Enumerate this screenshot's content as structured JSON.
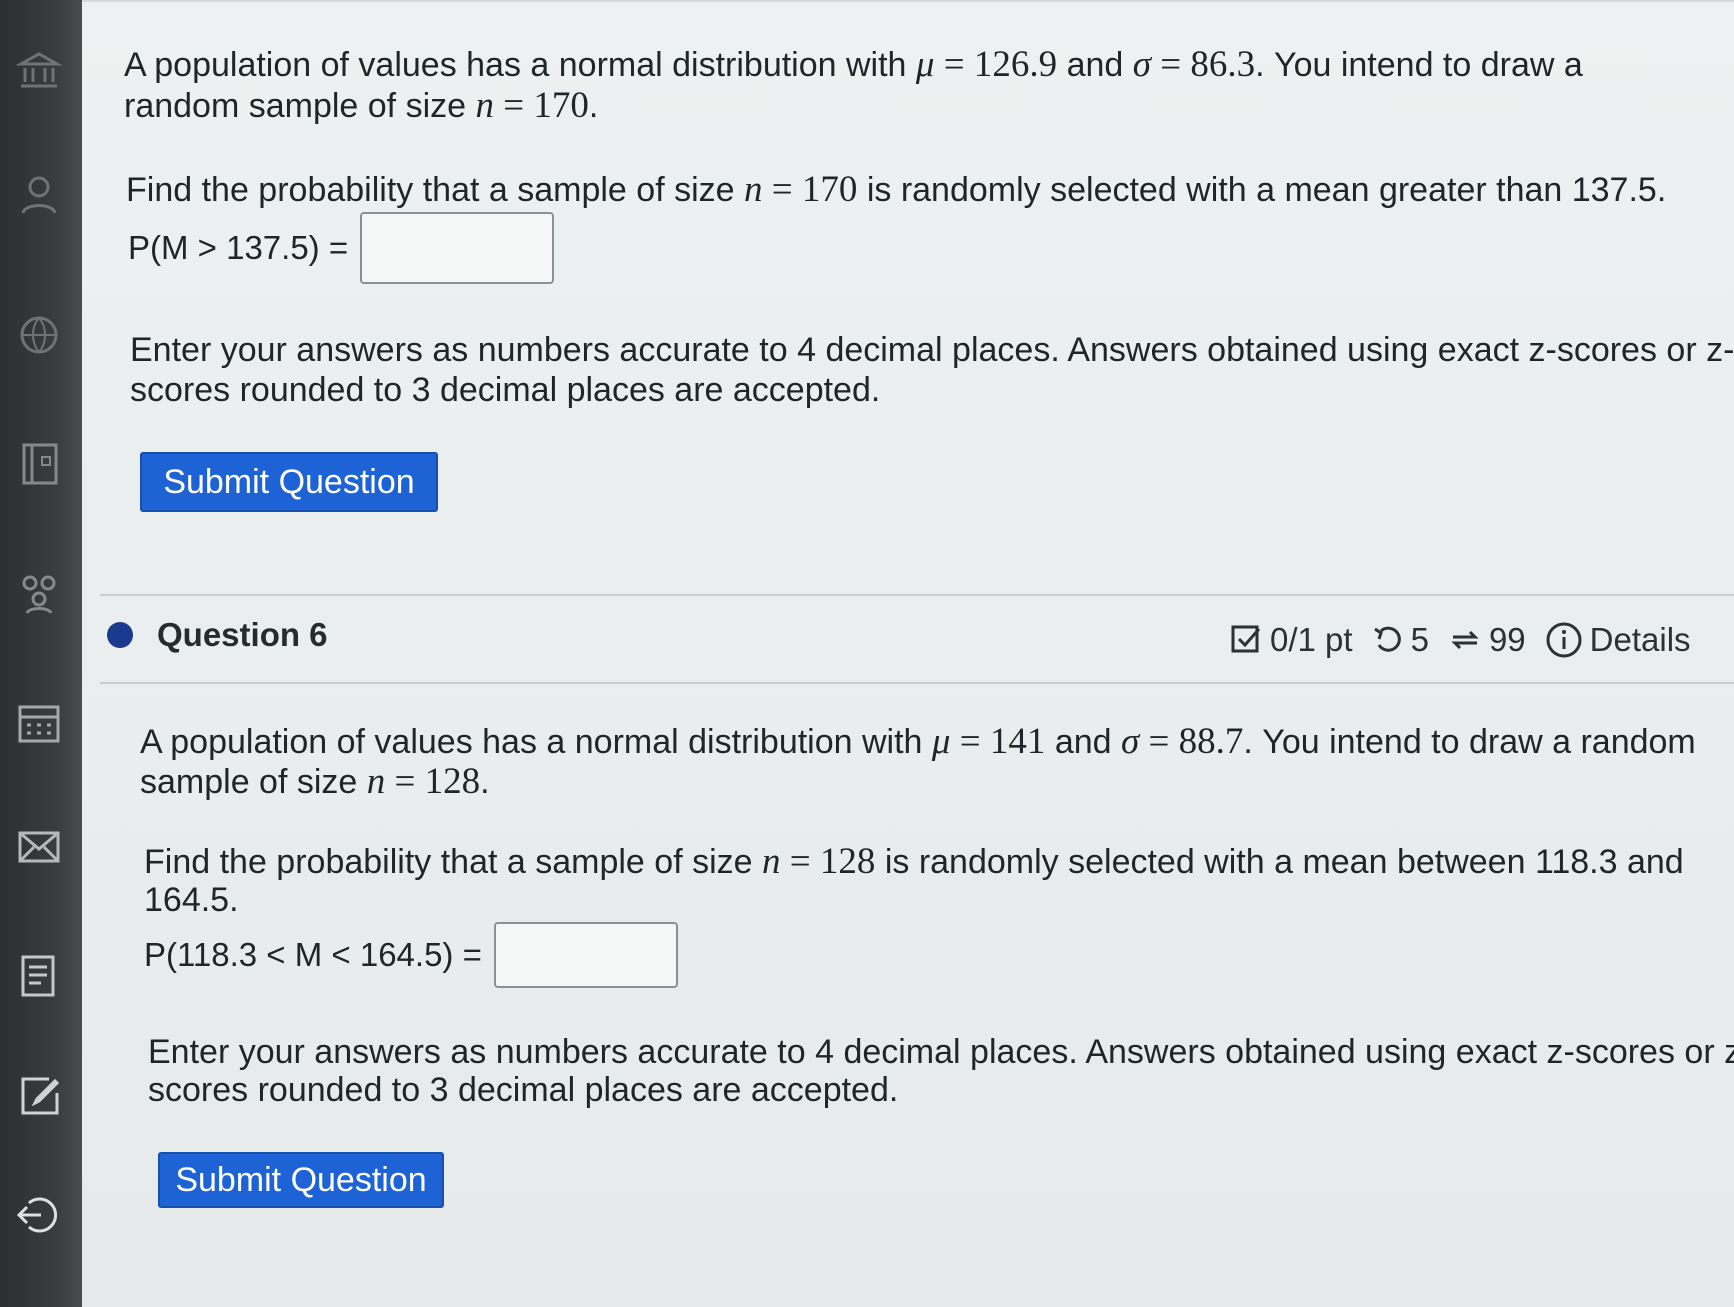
{
  "q5": {
    "line1_pre": "A population of values has a normal distribution with ",
    "mu_sym": "μ",
    "eq": " = ",
    "mu_val": "126.9",
    "and": " and ",
    "sigma_sym": "σ",
    "sigma_val": "86.3",
    "line1_post": ". You intend to draw a",
    "line2_pre": "random sample of size ",
    "n_sym": "n",
    "n_val": "170",
    "period": ".",
    "find_pre": "Find the probability that a sample of size ",
    "find_n": "170",
    "find_post": " is randomly selected with a mean greater than 137.5.",
    "answer_label": "P(M > 137.5) =",
    "answer_value": "",
    "instr_line1": "Enter your answers as numbers accurate to 4 decimal places. Answers obtained using exact z-scores or z-",
    "instr_line2": "scores rounded to 3 decimal places are accepted.",
    "submit_label": "Submit Question"
  },
  "q6": {
    "title": "Question 6",
    "points": "0/1 pt",
    "retries": "5",
    "attempts": "99",
    "details_label": "Details",
    "line1_pre": "A population of values has a normal distribution with ",
    "mu_sym": "μ",
    "eq": " = ",
    "mu_val": "141",
    "and": " and ",
    "sigma_sym": "σ",
    "sigma_val": "88.7",
    "line1_post": ". You intend to draw a random",
    "line2_pre": "sample of size ",
    "n_sym": "n",
    "n_val": "128",
    "period": ".",
    "find_pre": "Find the probability that a sample of size ",
    "find_n": "128",
    "find_post": " is randomly selected with a mean between 118.3 and",
    "find_line2": "164.5.",
    "answer_label": "P(118.3 < M < 164.5) =",
    "answer_value": "",
    "instr_line1": "Enter your answers as numbers accurate to 4 decimal places. Answers obtained using exact z-scores or z-",
    "instr_line2": "scores rounded to 3 decimal places are accepted.",
    "submit_label": "Submit Question"
  },
  "sidebar_icons": [
    "bank-icon",
    "person-icon",
    "globe-icon",
    "gradebook-icon",
    "people-icon",
    "calendar-icon",
    "mail-icon",
    "notes-icon",
    "edit-icon",
    "logout-icon"
  ],
  "colors": {
    "accent": "#1d63d6",
    "question_dot": "#1b3a8f",
    "sidebar": "#2c2f30"
  }
}
